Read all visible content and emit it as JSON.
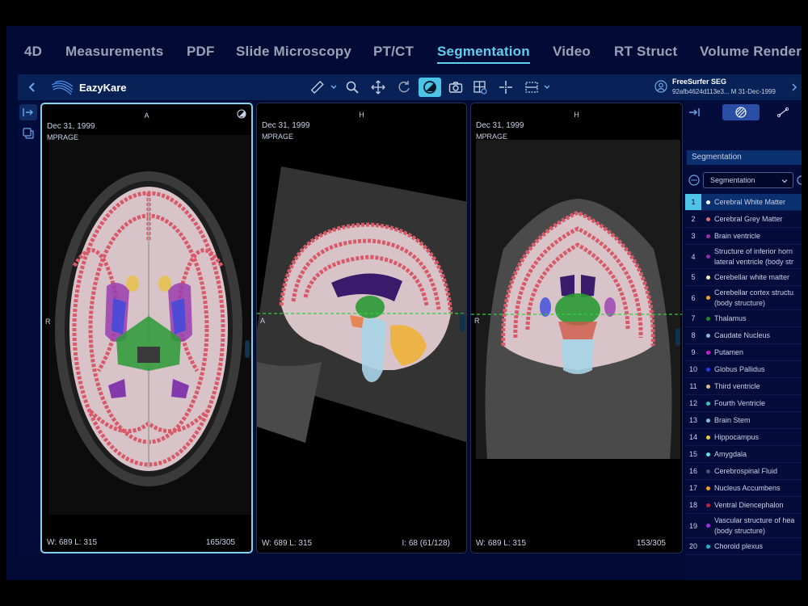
{
  "modes": [
    "4D",
    "Measurements",
    "PDF",
    "Slide Microscopy",
    "PT/CT",
    "Segmentation",
    "Video",
    "RT Struct",
    "Volume Rendering"
  ],
  "active_mode": "Segmentation",
  "toolbar": {
    "brand": "EazyKare",
    "study_name": "FreeSurfer SEG",
    "study_meta": "92afb4624d113e3...  M  31-Dec-1999",
    "tools": [
      "ruler-icon",
      "search-icon",
      "pan-icon",
      "rotate-icon",
      "contrast-icon",
      "camera-icon",
      "grid-icon",
      "crosshair-icon",
      "layout-icon"
    ]
  },
  "viewports": [
    {
      "orientation": "A",
      "date": "Dec 31, 1999",
      "series": "MPRAGE",
      "wl": "W:  689  L:  315",
      "slice": "165/305",
      "side_label": "R",
      "active": true
    },
    {
      "orientation": "H",
      "date": "Dec 31, 1999",
      "series": "MPRAGE",
      "wl": "W:  689  L:  315",
      "slice": "I: 68 (61/128)",
      "side_label": "A",
      "active": false
    },
    {
      "orientation": "H",
      "date": "Dec 31, 1999",
      "series": "MPRAGE",
      "wl": "W:  689  L:  315",
      "slice": "153/305",
      "side_label": "R",
      "active": false
    }
  ],
  "panel": {
    "title": "Segmentation",
    "select_value": "Segmentation",
    "segments": [
      {
        "num": "1",
        "name": "Cerebral White Matter",
        "color": "#ffffff",
        "selected": true
      },
      {
        "num": "2",
        "name": "Cerebral Grey Matter",
        "color": "#e06a73"
      },
      {
        "num": "3",
        "name": "Brain ventricle",
        "color": "#9b2fa8"
      },
      {
        "num": "4",
        "name": "Structure of inferior horn\nlateral ventricle (body str",
        "color": "#8a2bb0"
      },
      {
        "num": "5",
        "name": "Cerebellar white matter",
        "color": "#f2f2b6"
      },
      {
        "num": "6",
        "name": "Cerebellar cortex structu\n(body structure)",
        "color": "#f0a030"
      },
      {
        "num": "7",
        "name": "Thalamus",
        "color": "#1e8a2a"
      },
      {
        "num": "8",
        "name": "Caudate Nucleus",
        "color": "#8fb6e0"
      },
      {
        "num": "9",
        "name": "Putamen",
        "color": "#d01ad0"
      },
      {
        "num": "10",
        "name": "Globus Pallidus",
        "color": "#2a3ae0"
      },
      {
        "num": "11",
        "name": "Third ventricle",
        "color": "#e0b890"
      },
      {
        "num": "12",
        "name": "Fourth Ventricle",
        "color": "#3ac0b8"
      },
      {
        "num": "13",
        "name": "Brain Stem",
        "color": "#8ab8d8"
      },
      {
        "num": "14",
        "name": "Hippocampus",
        "color": "#e8d040"
      },
      {
        "num": "15",
        "name": "Amygdala",
        "color": "#60e0f0"
      },
      {
        "num": "16",
        "name": "Cerebrospinal Fluid",
        "color": "#505070"
      },
      {
        "num": "17",
        "name": "Nucleus Accumbens",
        "color": "#f0a020"
      },
      {
        "num": "18",
        "name": "Ventral Diencephalon",
        "color": "#c02040"
      },
      {
        "num": "19",
        "name": "Vascular structure of hea\n(body structure)",
        "color": "#a030e0"
      },
      {
        "num": "20",
        "name": "Choroid plexus",
        "color": "#20b8c8"
      }
    ]
  }
}
